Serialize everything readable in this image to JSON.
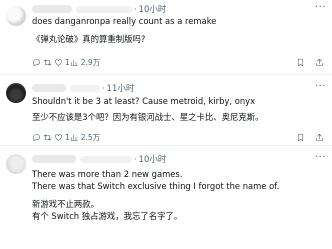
{
  "tweets": [
    {
      "time": "10小时",
      "lines": [
        "does danganronpa really count as a remake",
        "《弹丸论破》真的算重制版吗?"
      ],
      "stats": {
        "replies": "",
        "retweets": "",
        "likes": "1",
        "views": "2.9万"
      }
    },
    {
      "time": "11小时",
      "lines": [
        "Shouldn't it be 3 at least? Cause metroid, kirby, onyx",
        "至少不应该是3个吧？因为有银河战士、星之卡比、奥尼克斯。"
      ],
      "stats": {
        "replies": "",
        "retweets": "",
        "likes": "1",
        "views": "2.5万"
      }
    },
    {
      "time": "10小时",
      "lines": [
        "There was more than 2 new games.",
        "There was that Switch exclusive thing I forgot the name of.",
        "新游戏不止两款。",
        "有个 Switch 独占游戏，我忘了名字了。"
      ],
      "stats": {}
    }
  ],
  "separator": "·",
  "more_label": "···",
  "icons": {
    "reply": "reply-icon",
    "retweet": "retweet-icon",
    "like": "like-icon",
    "views": "views-icon",
    "bookmark": "bookmark-icon",
    "share": "share-icon"
  }
}
